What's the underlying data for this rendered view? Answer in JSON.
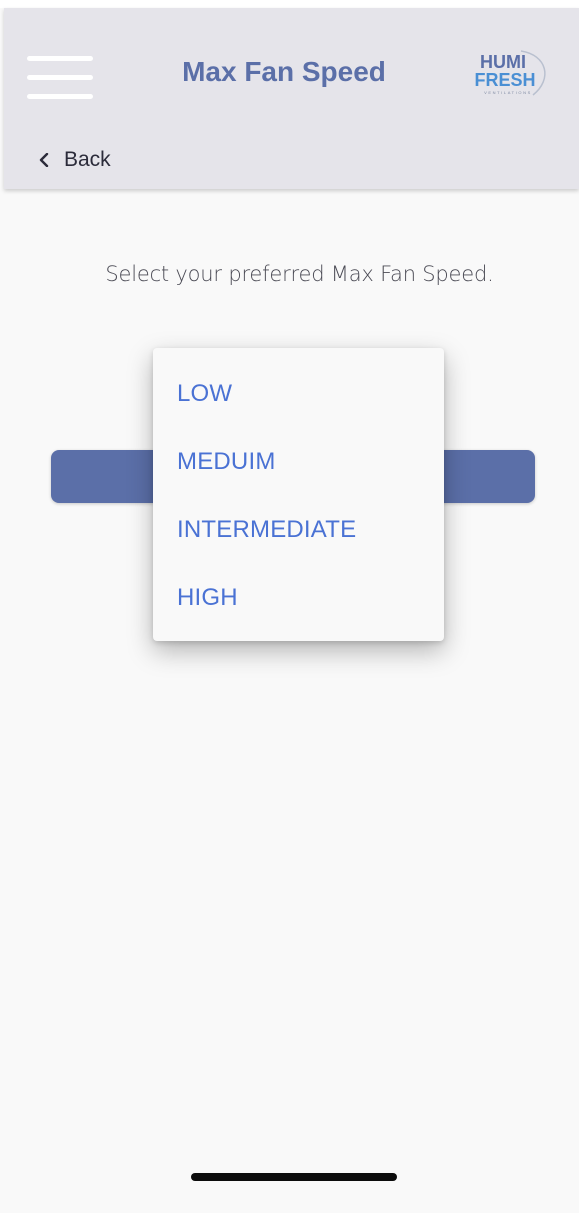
{
  "header": {
    "title": "Max Fan Speed",
    "logo_top": "HUMI",
    "logo_bottom": "FRESH",
    "logo_tagline": "VENTILATIONS"
  },
  "nav": {
    "back_label": "Back"
  },
  "main": {
    "prompt": "Select your preferred Max Fan Speed."
  },
  "dropdown": {
    "options": [
      "LOW",
      "MEDUIM",
      "INTERMEDIATE",
      "HIGH"
    ]
  },
  "colors": {
    "accent": "#5b6fa8",
    "option_text": "#4a72d4",
    "header_bg": "#e5e4ea",
    "page_bg": "#f9f9f9"
  },
  "icons": {
    "menu": "hamburger-icon",
    "back": "chevron-left-icon"
  }
}
